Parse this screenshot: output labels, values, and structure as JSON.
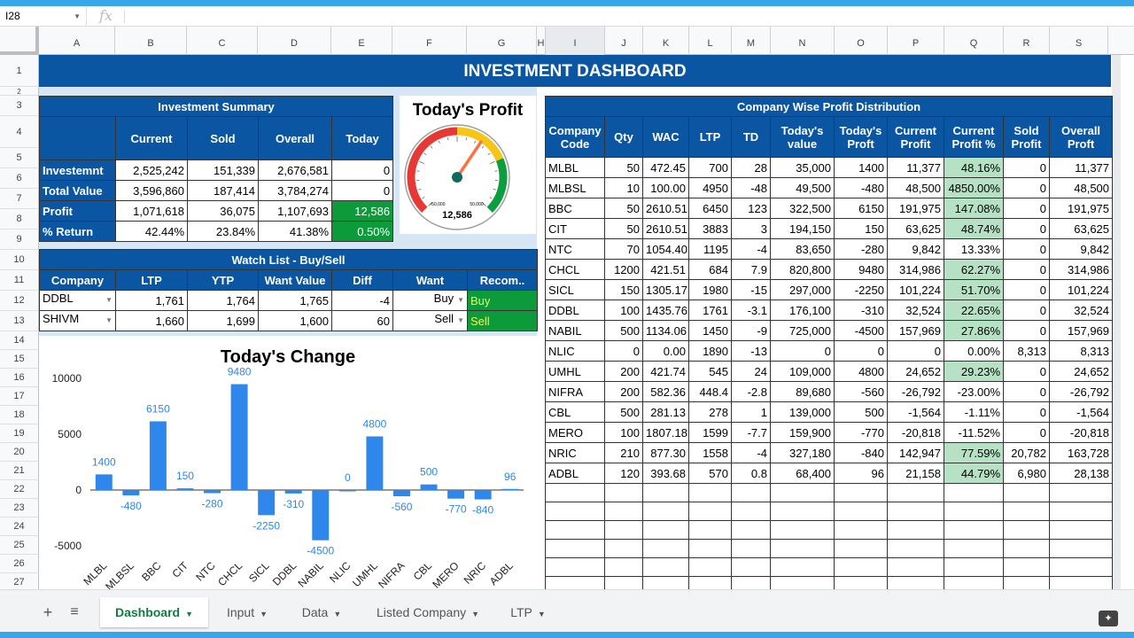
{
  "formula_bar": {
    "cell_ref": "I28",
    "fx": "fx"
  },
  "columns": [
    "A",
    "B",
    "C",
    "D",
    "E",
    "F",
    "G",
    "H",
    "I",
    "J",
    "K",
    "L",
    "M",
    "N",
    "O",
    "P",
    "Q",
    "R",
    "S"
  ],
  "rows": [
    "1",
    "2",
    "3",
    "4",
    "5",
    "6",
    "7",
    "8",
    "9",
    "10",
    "11",
    "12",
    "13",
    "14",
    "15",
    "16",
    "17",
    "18",
    "19",
    "20",
    "21",
    "22",
    "23",
    "24",
    "25",
    "26",
    "27"
  ],
  "banner": "INVESTMENT DASHBOARD",
  "summary": {
    "title": "Investment Summary",
    "headers": [
      "",
      "Current",
      "Sold",
      "Overall",
      "Today"
    ],
    "rows": [
      {
        "label": "Investemnt",
        "v": [
          "2,525,242",
          "151,339",
          "2,676,581",
          "0"
        ]
      },
      {
        "label": "Total Value",
        "v": [
          "3,596,860",
          "187,414",
          "3,784,274",
          "0"
        ]
      },
      {
        "label": "Profit",
        "v": [
          "1,071,618",
          "36,075",
          "1,107,693",
          "12,586"
        ]
      },
      {
        "label": "% Return",
        "v": [
          "42.44%",
          "23.84%",
          "41.38%",
          "0.50%"
        ]
      }
    ]
  },
  "gauge": {
    "title": "Today's Profit",
    "min_label": "-50,000",
    "max_label": "50,000",
    "value": "12,586",
    "fraction": 0.626,
    "colors": {
      "red": "#e53935",
      "yellow": "#f5c518",
      "green": "#0c9d3e",
      "needle": "#ff7043",
      "hub": "#0e6b5c"
    }
  },
  "watch": {
    "title": "Watch List - Buy/Sell",
    "headers": [
      "Company",
      "LTP",
      "YTP",
      "Want Value",
      "Diff",
      "Want",
      "Recom.."
    ],
    "rows": [
      {
        "company": "DDBL",
        "ltp": "1,761",
        "ytp": "1,764",
        "want_value": "1,765",
        "diff": "-4",
        "want": "Buy",
        "recom": "Buy"
      },
      {
        "company": "SHIVM",
        "ltp": "1,660",
        "ytp": "1,699",
        "want_value": "1,600",
        "diff": "60",
        "want": "Sell",
        "recom": "Sell"
      }
    ]
  },
  "distribution": {
    "title": "Company Wise Profit Distribution",
    "headers": [
      [
        "Company",
        "Code"
      ],
      [
        "Qty",
        ""
      ],
      [
        "WAC",
        ""
      ],
      [
        "LTP",
        ""
      ],
      [
        "TD",
        ""
      ],
      [
        "Today's",
        "value"
      ],
      [
        "Today's",
        "Proft"
      ],
      [
        "Current",
        "Profit"
      ],
      [
        "Current",
        "Profit %"
      ],
      [
        "Sold",
        "Profit"
      ],
      [
        "Overall",
        "Proft"
      ]
    ],
    "rows": [
      [
        "MLBL",
        "50",
        "472.45",
        "700",
        "28",
        "35,000",
        "1400",
        "11,377",
        "48.16%",
        "0",
        "11,377"
      ],
      [
        "MLBSL",
        "10",
        "100.00",
        "4950",
        "-48",
        "49,500",
        "-480",
        "48,500",
        "4850.00%",
        "0",
        "48,500"
      ],
      [
        "BBC",
        "50",
        "2610.51",
        "6450",
        "123",
        "322,500",
        "6150",
        "191,975",
        "147.08%",
        "0",
        "191,975"
      ],
      [
        "CIT",
        "50",
        "2610.51",
        "3883",
        "3",
        "194,150",
        "150",
        "63,625",
        "48.74%",
        "0",
        "63,625"
      ],
      [
        "NTC",
        "70",
        "1054.40",
        "1195",
        "-4",
        "83,650",
        "-280",
        "9,842",
        "13.33%",
        "0",
        "9,842"
      ],
      [
        "CHCL",
        "1200",
        "421.51",
        "684",
        "7.9",
        "820,800",
        "9480",
        "314,986",
        "62.27%",
        "0",
        "314,986"
      ],
      [
        "SICL",
        "150",
        "1305.17",
        "1980",
        "-15",
        "297,000",
        "-2250",
        "101,224",
        "51.70%",
        "0",
        "101,224"
      ],
      [
        "DDBL",
        "100",
        "1435.76",
        "1761",
        "-3.1",
        "176,100",
        "-310",
        "32,524",
        "22.65%",
        "0",
        "32,524"
      ],
      [
        "NABIL",
        "500",
        "1134.06",
        "1450",
        "-9",
        "725,000",
        "-4500",
        "157,969",
        "27.86%",
        "0",
        "157,969"
      ],
      [
        "NLIC",
        "0",
        "0.00",
        "1890",
        "-13",
        "0",
        "0",
        "0",
        "0.00%",
        "8,313",
        "8,313"
      ],
      [
        "UMHL",
        "200",
        "421.74",
        "545",
        "24",
        "109,000",
        "4800",
        "24,652",
        "29.23%",
        "0",
        "24,652"
      ],
      [
        "NIFRA",
        "200",
        "582.36",
        "448.4",
        "-2.8",
        "89,680",
        "-560",
        "-26,792",
        "-23.00%",
        "0",
        "-26,792"
      ],
      [
        "CBL",
        "500",
        "281.13",
        "278",
        "1",
        "139,000",
        "500",
        "-1,564",
        "-1.11%",
        "0",
        "-1,564"
      ],
      [
        "MERO",
        "100",
        "1807.18",
        "1599",
        "-7.7",
        "159,900",
        "-770",
        "-20,818",
        "-11.52%",
        "0",
        "-20,818"
      ],
      [
        "NRIC",
        "210",
        "877.30",
        "1558",
        "-4",
        "327,180",
        "-840",
        "142,947",
        "77.59%",
        "20,782",
        "163,728"
      ],
      [
        "ADBL",
        "120",
        "393.68",
        "570",
        "0.8",
        "68,400",
        "96",
        "21,158",
        "44.79%",
        "6,980",
        "28,138"
      ]
    ],
    "green_pct_rows": [
      0,
      1,
      2,
      3,
      5,
      6,
      7,
      8,
      10,
      14,
      15
    ]
  },
  "chart_data": {
    "type": "bar",
    "title": "Today's Change",
    "categories": [
      "MLBL",
      "MLBSL",
      "BBC",
      "CIT",
      "NTC",
      "CHCL",
      "SICL",
      "DDBL",
      "NABIL",
      "NLIC",
      "UMHL",
      "NIFRA",
      "CBL",
      "MERO",
      "NRIC",
      "ADBL"
    ],
    "values": [
      1400,
      -480,
      6150,
      150,
      -280,
      9480,
      -2250,
      -310,
      -4500,
      0,
      4800,
      -560,
      500,
      -770,
      -840,
      96
    ],
    "yticks": [
      10000,
      5000,
      0,
      -5000
    ],
    "ytick_labels": [
      "10000",
      "5000",
      "0",
      "-5000"
    ],
    "ylim": [
      -6000,
      11000
    ],
    "bar_color": "#2f86eb",
    "label_color": "#2f86eb",
    "grid": false
  },
  "tabs": [
    {
      "label": "Dashboard",
      "active": true
    },
    {
      "label": "Input",
      "active": false
    },
    {
      "label": "Data",
      "active": false
    },
    {
      "label": "Listed Company",
      "active": false
    },
    {
      "label": "LTP",
      "active": false
    }
  ],
  "icons": {
    "add_sheet": "plus-icon",
    "all_sheets": "menu-icon",
    "explore": "explore-icon"
  }
}
